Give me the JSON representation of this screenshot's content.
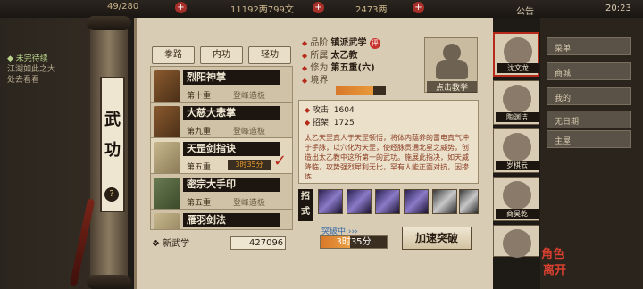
{
  "topbar": {
    "stamina": "49/280",
    "money": "11192两799文",
    "gold": "2473两",
    "notice": "公告",
    "clock": "20:23"
  },
  "quest": {
    "title": "未完待续",
    "line1": "江湖如此之大",
    "line2": "处去看看"
  },
  "scroll_title": [
    "武",
    "功"
  ],
  "tabs": [
    "拳路",
    "内功",
    "轻功"
  ],
  "skills": [
    {
      "name": "烈阳神掌",
      "level": "第十重",
      "status": "登峰造极"
    },
    {
      "name": "大慈大悲掌",
      "level": "第九重",
      "status": "登峰造极"
    },
    {
      "name": "天罡剑指诀",
      "level": "第五重",
      "timer": "3时35分"
    },
    {
      "name": "密宗大手印",
      "level": "第五重",
      "status": "登峰造极"
    },
    {
      "name": "雁羽剑法",
      "level": "",
      "status": ""
    }
  ],
  "bottom": {
    "new_skill": "新武学",
    "count": "427096"
  },
  "info": {
    "rank_label": "品阶",
    "rank_value": "镇派武学",
    "rank_badge": "评",
    "sect_label": "所属",
    "sect_value": "太乙教",
    "cult_label": "修为",
    "cult_value": "第五重(六)",
    "realm_label": "境界",
    "realm_fill": 0.75
  },
  "portrait": {
    "label": "点击教学"
  },
  "stats": {
    "atk_label": "攻击",
    "atk_value": "1604",
    "def_label": "招架",
    "def_value": "1725",
    "desc": "太乙天罡真人于天罡顿悟，将体内蕴养的雷电真气冲于手脉，以穴化为天罡，使经脉贯通北星之威势，创造出太乙教中这所第一的武功。施展此指决，如天威降临，攻势强烈犀利无比，罕有人能正面对抗，因掺炼"
  },
  "moves_label": "招式",
  "progress": {
    "label": "突破中",
    "text": "3时35分",
    "fill": 0.45
  },
  "accel_button": "加速突破",
  "heroes": [
    "沈文龙",
    "陶渊洁",
    "岁棋云",
    "商昊乾",
    ""
  ],
  "right_menu": [
    "菜单",
    "商城",
    "我的",
    "无日期",
    "主屋"
  ],
  "corner": [
    "角色",
    "离开"
  ]
}
